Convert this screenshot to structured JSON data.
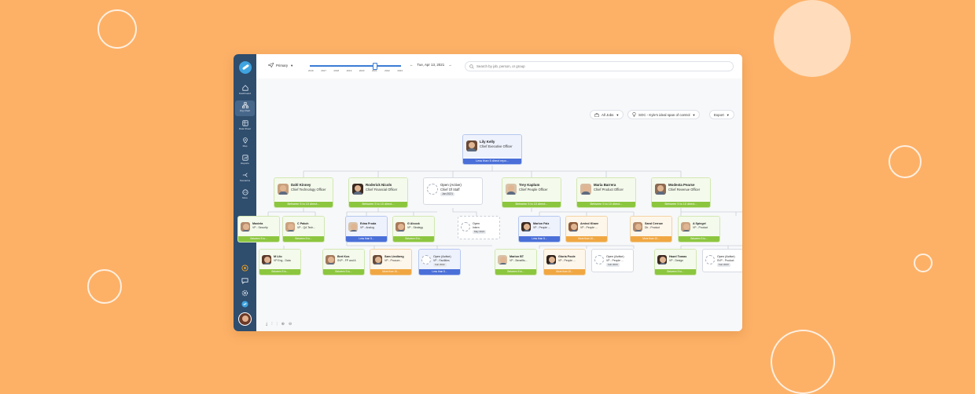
{
  "topbar": {
    "view_label": "Primary",
    "timeline_years": [
      "2016",
      "2017",
      "2018",
      "2019",
      "2020",
      "2021",
      "2022",
      "2023"
    ],
    "date_label": "Tue, Apr 13, 2021",
    "search_placeholder": "Search by job, person, or group"
  },
  "sidebar": {
    "items": [
      {
        "label": "Dashboard",
        "icon": "home-icon"
      },
      {
        "label": "Org Chart",
        "icon": "org-chart-icon"
      },
      {
        "label": "Data Sheet",
        "icon": "data-sheet-icon"
      },
      {
        "label": "Map",
        "icon": "map-pin-icon"
      },
      {
        "label": "Reports",
        "icon": "reports-icon"
      },
      {
        "label": "Scenarios",
        "icon": "scenarios-icon"
      },
      {
        "label": "More",
        "icon": "more-icon"
      }
    ],
    "bottom_icons": [
      "target-icon",
      "chat-icon",
      "settings-icon",
      "brand-icon"
    ]
  },
  "filters": {
    "jobs_label": "All Jobs",
    "span_label": "SOC - Kyle's ideal span of control",
    "export_label": "Export"
  },
  "colors": {
    "green": "#8cc63f",
    "blue": "#4a6fd8",
    "orange": "#f0a742",
    "sidebar": "#2f4d6d"
  },
  "org": {
    "ceo": {
      "name": "Lily Kelly",
      "title": "Chief Executive Officer",
      "status": "Less than 5 direct repo..."
    },
    "executives": [
      {
        "name": "Dahl Kinney",
        "title": "Chief Technology Officer",
        "status": "Between 5 to 10 direct..."
      },
      {
        "name": "Roderick Nicols",
        "title": "Chief Financial Officer",
        "status": "Between 5 to 10 direct..."
      },
      {
        "name": "Open (Active)",
        "title": "Chief Of Staff",
        "tag": "Jan 2021"
      },
      {
        "name": "Trey Kaplum",
        "title": "Chief People Officer",
        "status": "Between 5 to 10 direct..."
      },
      {
        "name": "Maria Barrera",
        "title": "Chief Product Officer",
        "status": "Between 5 to 10 direct..."
      },
      {
        "name": "Modesta Pearse",
        "title": "Chief Revenue Officer",
        "status": "Between 5 to 10 direct..."
      }
    ],
    "level2": [
      {
        "name": "Maxiela",
        "title": "VP - Security",
        "status": "Between 5 to..."
      },
      {
        "name": "C Pakch",
        "title": "VP - QA Tech...",
        "status": "Between 5 to..."
      },
      {
        "name": "Edna Froda",
        "title": "VP - Analog",
        "status": "Less than 5..."
      },
      {
        "name": "G Alcock",
        "title": "VP - Strategy",
        "status": "Between 5 to..."
      },
      {
        "name": "Open",
        "title": "Intern",
        "tag": "May 2021"
      },
      {
        "name": "Marlon Falz",
        "title": "VP - People ...",
        "status": "Less than 5..."
      },
      {
        "name": "Arvind Khare",
        "title": "VP - People ...",
        "status": "More than 10..."
      },
      {
        "name": "Sand Cerrow",
        "title": "Dir - Product",
        "status": "More than 10..."
      },
      {
        "name": "A Spiegel",
        "title": "VP - Product",
        "status": "Between 5 to..."
      }
    ],
    "level3": [
      {
        "name": "M Lilo",
        "title": "VP Eng - Data",
        "status": "Between 5 to..."
      },
      {
        "name": "Bert Kos",
        "title": "SVP - FP and A",
        "status": "Between 5 to..."
      },
      {
        "name": "Sam Lindberg",
        "title": "VP - Procure...",
        "status": "More than 10..."
      },
      {
        "name": "Open (Active)",
        "title": "VP - Facilities",
        "tag": "Feb 2022",
        "status": "Less than 5..."
      },
      {
        "name": "Marlon BT",
        "title": "VP - Benefits...",
        "status": "Between 5 to..."
      },
      {
        "name": "Gloria Poole",
        "title": "VP - People ...",
        "status": "More than 10..."
      },
      {
        "name": "Open (Active)",
        "title": "VP - People ...",
        "tag": "Feb 2023"
      },
      {
        "name": "Hazel Tomas",
        "title": "VP - Design",
        "status": "Between 5 to..."
      },
      {
        "name": "Open (Active)",
        "title": "SVP - Product",
        "tag": "Feb 2023"
      }
    ]
  }
}
